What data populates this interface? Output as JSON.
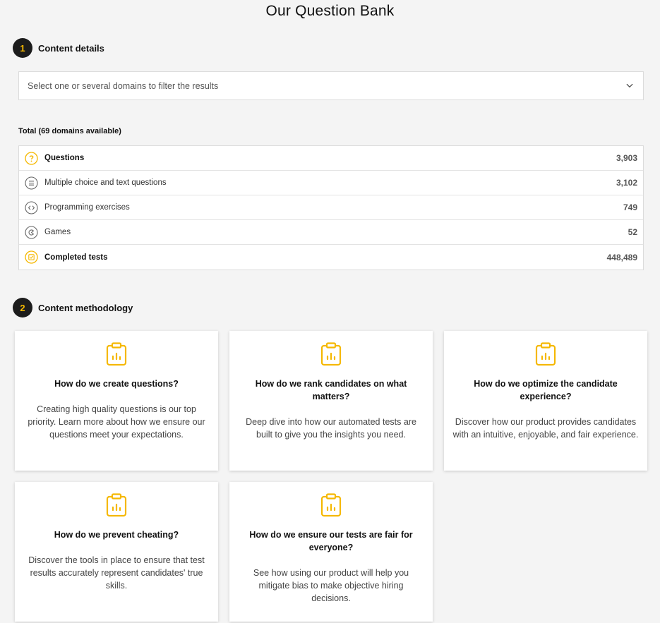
{
  "page": {
    "title": "Our Question Bank"
  },
  "accent_color": "#f5b800",
  "section1": {
    "number": "1",
    "title": "Content details",
    "domain_select": {
      "placeholder": "Select one or several domains to filter the results",
      "icon": "chevron-down-icon"
    },
    "total_label": "Total (69 domains available)",
    "rows": [
      {
        "icon": "question-icon",
        "label": "Questions",
        "value": "3,903",
        "bold": true
      },
      {
        "icon": "list-icon",
        "label": "Multiple choice and text questions",
        "value": "3,102",
        "bold": false
      },
      {
        "icon": "code-icon",
        "label": "Programming exercises",
        "value": "749",
        "bold": false
      },
      {
        "icon": "game-icon",
        "label": "Games",
        "value": "52",
        "bold": false
      },
      {
        "icon": "checked-test-icon",
        "label": "Completed tests",
        "value": "448,489",
        "bold": true
      }
    ]
  },
  "section2": {
    "number": "2",
    "title": "Content methodology",
    "cards": [
      {
        "icon": "clipboard-chart-icon",
        "title": "How do we create questions?",
        "description": "Creating high quality questions is our top priority. Learn more about how we ensure our questions meet your expectations."
      },
      {
        "icon": "clipboard-chart-icon",
        "title": "How do we rank candidates on what matters?",
        "description": "Deep dive into how our automated tests are built to give you the insights you need."
      },
      {
        "icon": "clipboard-chart-icon",
        "title": "How do we optimize the candidate experience?",
        "description": "Discover how our product provides candidates with an intuitive, enjoyable, and fair experience."
      },
      {
        "icon": "clipboard-chart-icon",
        "title": "How do we prevent cheating?",
        "description": "Discover the tools in place to ensure that test results accurately represent candidates' true skills."
      },
      {
        "icon": "clipboard-chart-icon",
        "title": "How do we ensure our tests are fair for everyone?",
        "description": "See how using our product will help you mitigate bias to make objective hiring decisions."
      }
    ]
  }
}
